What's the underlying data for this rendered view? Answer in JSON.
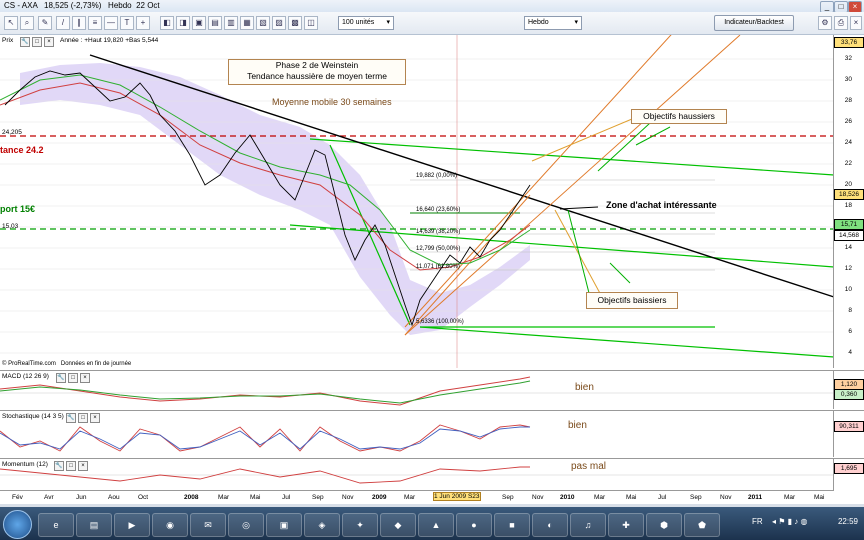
{
  "window": {
    "title": "CS - AXA   18,525 (-2,73%)   Hebdo  22 Oct"
  },
  "toolbar": {
    "units_select": "100 unités",
    "period_select": "Hebdo",
    "indicator_button": "Indicateur/Backtest"
  },
  "price_panel": {
    "label": "Prix",
    "info": "Année : +Haut 19,820 +Bas 5,544",
    "copyright": "© ProRealTime.com   Données en fin de journée",
    "y_ticks": [
      "32",
      "30",
      "28",
      "26",
      "24",
      "22",
      "20",
      "18",
      "16",
      "14",
      "12",
      "10",
      "8",
      "6",
      "4"
    ],
    "top_value": "33,76",
    "price_current": "18,526",
    "price_ma": "15,71",
    "price_support": "14,568",
    "left_labels": {
      "resistance_value": "24,205",
      "resistance": "tance 24.2",
      "support_value": "15,03",
      "support": "port 15€"
    },
    "fib_labels": [
      "19,882 (0,00%)",
      "16,640 (23,60%)",
      "14,639 (38,20%)",
      "12,799 (50,00%)",
      "11,071 (61,80%)",
      "5,6336 (100,00%)"
    ],
    "annotations": {
      "phase": "Phase 2 de Weinstein\nTendance haussière de moyen terme",
      "ma30": "Moyenne mobile 30 semaines",
      "obj_haussiers": "Objectifs haussiers",
      "zone_achat": "Zone d'achat intéressante",
      "obj_baissiers": "Objectifs baissiers"
    }
  },
  "macd_panel": {
    "label": "MACD (12 26 9)",
    "v1": "1,120",
    "v2": "0,360",
    "comment": "bien"
  },
  "stoch_panel": {
    "label": "Stochastique (14 3 5)",
    "v1": "90,311",
    "comment": "bien"
  },
  "momentum_panel": {
    "label": "Momentum (12)",
    "v1": "1,695",
    "comment": "pas mal"
  },
  "x_axis": [
    "Fév",
    "Avr",
    "Jun",
    "Aou",
    "Oct",
    "2008",
    "Mar",
    "Mai",
    "Jul",
    "Sep",
    "Nov",
    "2009",
    "Mar",
    "1 Jun 2009 S23",
    "Sep",
    "Nov",
    "2010",
    "Mar",
    "Mai",
    "Jul",
    "Sep",
    "Nov",
    "2011",
    "Mar",
    "Mai"
  ],
  "taskbar": {
    "lang": "FR",
    "time": "22:59"
  },
  "colors": {
    "accent_orange": "#e07a2a",
    "green": "#00b000",
    "red_dashed": "#c00000",
    "ma_red": "#d04040",
    "ma_green": "#30b030",
    "cloud": "#c9b8f0"
  },
  "chart_data": {
    "type": "line",
    "series": [],
    "ylim": [
      3,
      33
    ],
    "horizontal_levels": {
      "resistance": 24.2,
      "support": 15
    },
    "fibonacci": [
      19.882,
      16.64,
      14.639,
      12.799,
      11.071,
      5.6336
    ]
  }
}
